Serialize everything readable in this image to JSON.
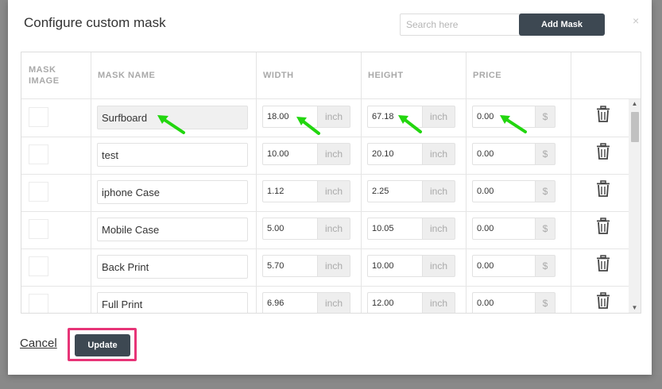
{
  "modal": {
    "title": "Configure custom mask",
    "search_placeholder": "Search here",
    "add_mask_label": "Add Mask",
    "close_label": "×"
  },
  "table": {
    "headers": [
      "MASK IMAGE",
      "MASK NAME",
      "WIDTH",
      "HEIGHT",
      "PRICE"
    ],
    "unit_label": "inch",
    "price_unit": "$",
    "rows": [
      {
        "name": "Surfboard",
        "width": "18.00",
        "height": "67.18",
        "price": "0.00"
      },
      {
        "name": "test",
        "width": "10.00",
        "height": "20.10",
        "price": "0.00"
      },
      {
        "name": "iphone Case",
        "width": "1.12",
        "height": "2.25",
        "price": "0.00"
      },
      {
        "name": "Mobile Case",
        "width": "5.00",
        "height": "10.05",
        "price": "0.00"
      },
      {
        "name": "Back Print",
        "width": "5.70",
        "height": "10.00",
        "price": "0.00"
      },
      {
        "name": "Full Print",
        "width": "6.96",
        "height": "12.00",
        "price": "0.00"
      }
    ]
  },
  "footer": {
    "cancel_label": "Cancel",
    "update_label": "Update"
  },
  "annotation_colors": {
    "arrow": "#22d60f",
    "highlight": "#e73477"
  }
}
